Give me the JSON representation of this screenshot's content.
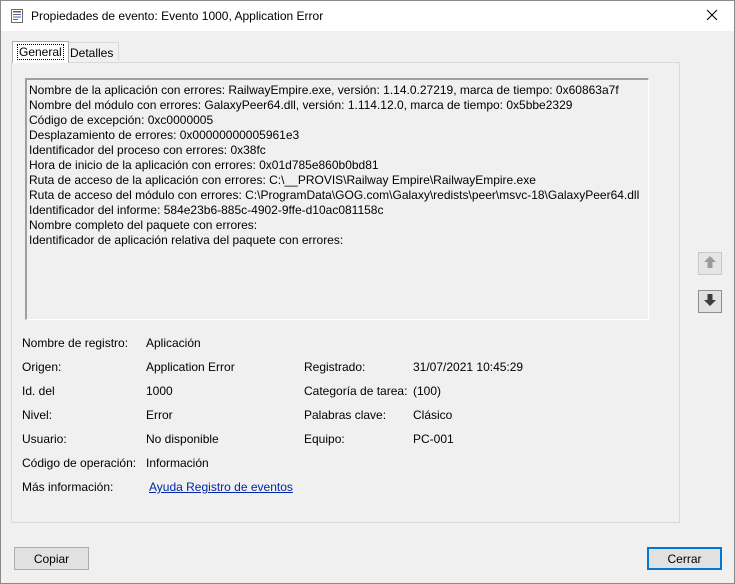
{
  "window": {
    "title": "Propiedades de evento: Evento 1000, Application Error",
    "icon": "event-log-icon",
    "close_icon": "close-icon"
  },
  "tabs": [
    {
      "label": "General",
      "selected": true
    },
    {
      "label": "Detalles",
      "selected": false
    }
  ],
  "description": {
    "lines": [
      "Nombre de la aplicación con errores: RailwayEmpire.exe, versión: 1.14.0.27219, marca de tiempo: 0x60863a7f",
      "Nombre del módulo con errores: GalaxyPeer64.dll, versión: 1.114.12.0, marca de tiempo: 0x5bbe2329",
      "Código de excepción: 0xc0000005",
      "Desplazamiento de errores: 0x00000000005961e3",
      "Identificador del proceso con errores: 0x38fc",
      "Hora de inicio de la aplicación con errores: 0x01d785e860b0bd81",
      "Ruta de acceso de la aplicación con errores: C:\\__PROVIS\\Railway Empire\\RailwayEmpire.exe",
      "Ruta de acceso del módulo con errores: C:\\ProgramData\\GOG.com\\Galaxy\\redists\\peer\\msvc-18\\GalaxyPeer64.dll",
      "Identificador del informe: 584e23b6-885c-4902-9ffe-d10ac081158c",
      "Nombre completo del paquete con errores:",
      "Identificador de aplicación relativa del paquete con errores:"
    ]
  },
  "nav": {
    "up_icon": "arrow-up-icon",
    "down_icon": "arrow-down-icon"
  },
  "fields": {
    "log_name_label": "Nombre de registro:",
    "log_name_value": "Aplicación",
    "source_label": "Origen:",
    "source_value": "Application Error",
    "logged_label": "Registrado:",
    "logged_value": "31/07/2021 10:45:29",
    "event_id_label": "Id. del",
    "event_id_value": "1000",
    "task_category_label": "Categoría de tarea:",
    "task_category_value": "(100)",
    "level_label": "Nivel:",
    "level_value": "Error",
    "keywords_label": "Palabras clave:",
    "keywords_value": "Clásico",
    "user_label": "Usuario:",
    "user_value": "No disponible",
    "computer_label": "Equipo:",
    "computer_value": "PC-001",
    "opcode_label": "Código de operación:",
    "opcode_value": "Información",
    "more_info_label": "Más información:",
    "more_info_link": "Ayuda Registro de eventos"
  },
  "buttons": {
    "copy_label": "Copiar",
    "close_label": "Cerrar"
  }
}
